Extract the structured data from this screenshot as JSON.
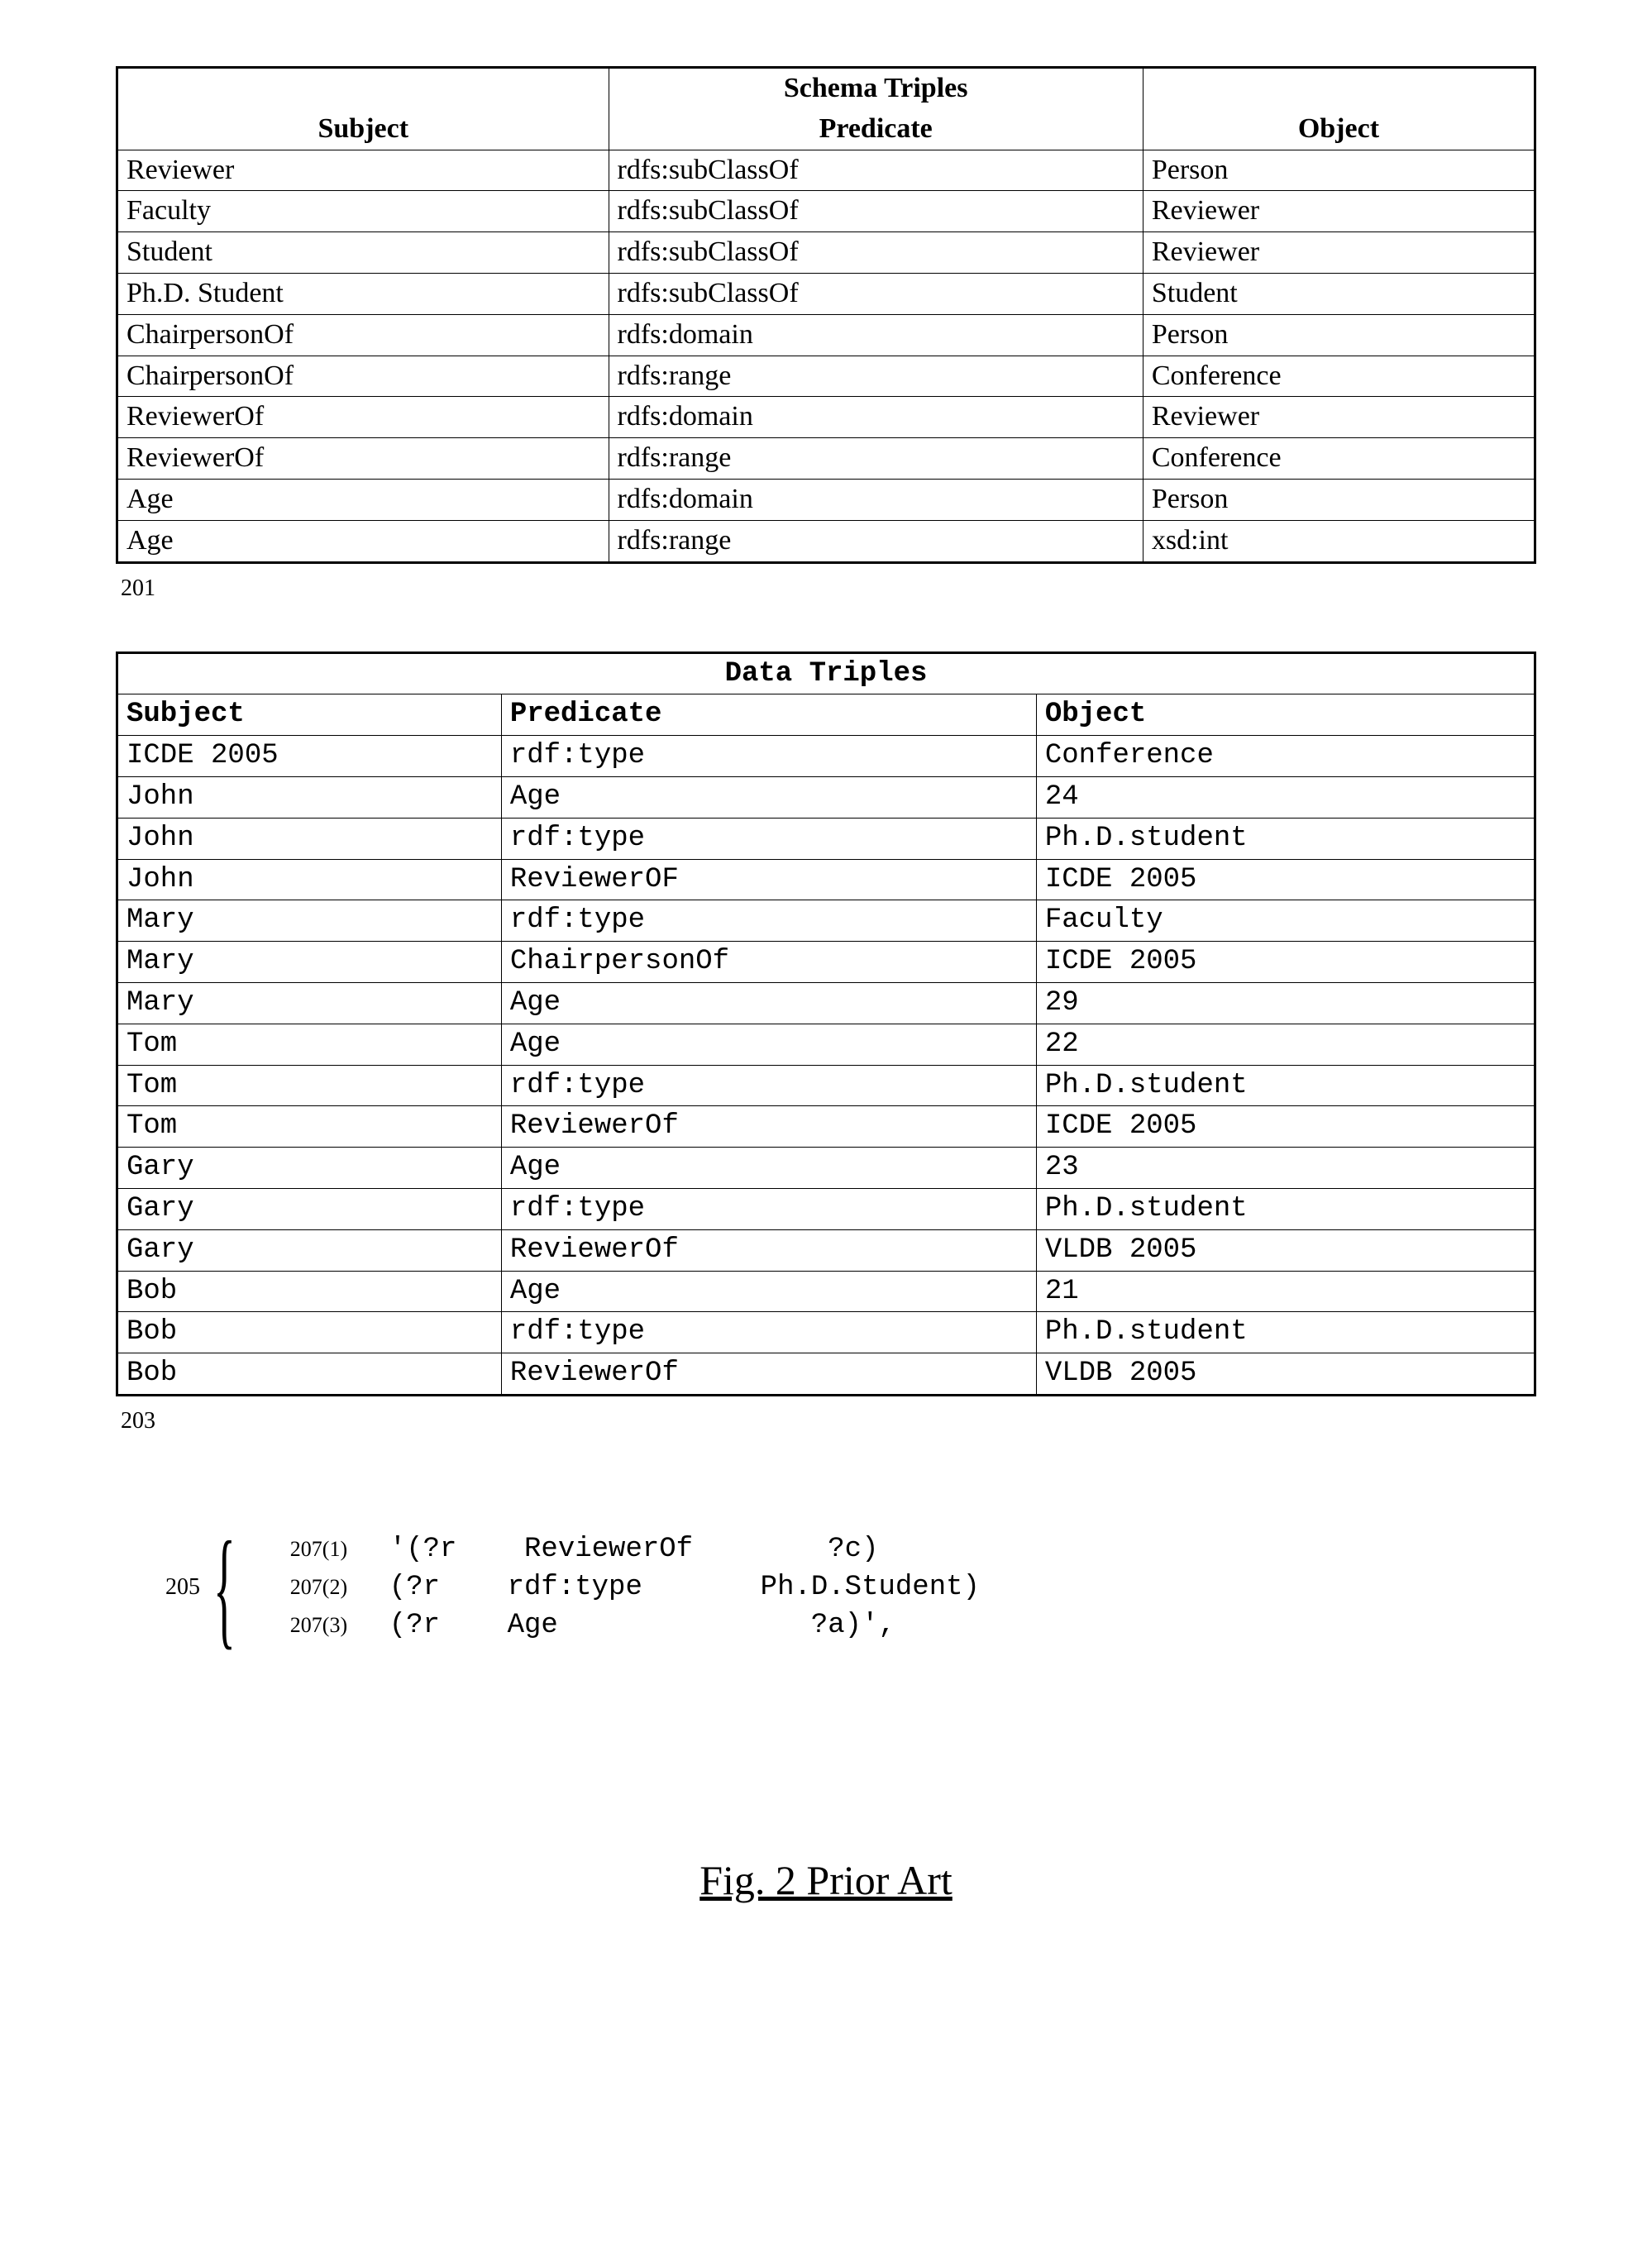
{
  "schema_table": {
    "title": "Schema Triples",
    "headers": {
      "subject": "Subject",
      "predicate": "Predicate",
      "object": "Object"
    },
    "rows": [
      {
        "s": "Reviewer",
        "p": "rdfs:subClassOf",
        "o": "Person"
      },
      {
        "s": "Faculty",
        "p": "rdfs:subClassOf",
        "o": "Reviewer"
      },
      {
        "s": "Student",
        "p": "rdfs:subClassOf",
        "o": "Reviewer"
      },
      {
        "s": "Ph.D. Student",
        "p": "rdfs:subClassOf",
        "o": "Student"
      },
      {
        "s": "ChairpersonOf",
        "p": "rdfs:domain",
        "o": "Person"
      },
      {
        "s": "ChairpersonOf",
        "p": "rdfs:range",
        "o": "Conference"
      },
      {
        "s": "ReviewerOf",
        "p": "rdfs:domain",
        "o": "Reviewer"
      },
      {
        "s": "ReviewerOf",
        "p": "rdfs:range",
        "o": "Conference"
      },
      {
        "s": "Age",
        "p": "rdfs:domain",
        "o": "Person"
      },
      {
        "s": "Age",
        "p": "rdfs:range",
        "o": "xsd:int"
      }
    ],
    "ref": "201"
  },
  "data_table": {
    "title": "Data Triples",
    "headers": {
      "subject": "Subject",
      "predicate": "Predicate",
      "object": "Object"
    },
    "rows": [
      {
        "s": "ICDE 2005",
        "p": "rdf:type",
        "o": "Conference"
      },
      {
        "s": "John",
        "p": "Age",
        "o": "24"
      },
      {
        "s": "John",
        "p": "rdf:type",
        "o": "Ph.D.student"
      },
      {
        "s": "John",
        "p": "ReviewerOF",
        "o": "ICDE 2005"
      },
      {
        "s": "Mary",
        "p": "rdf:type",
        "o": "Faculty"
      },
      {
        "s": "Mary",
        "p": "ChairpersonOf",
        "o": "ICDE 2005"
      },
      {
        "s": "Mary",
        "p": "Age",
        "o": "29"
      },
      {
        "s": "Tom",
        "p": "Age",
        "o": "22"
      },
      {
        "s": "Tom",
        "p": "rdf:type",
        "o": "Ph.D.student"
      },
      {
        "s": "Tom",
        "p": "ReviewerOf",
        "o": "ICDE 2005"
      },
      {
        "s": "Gary",
        "p": "Age",
        "o": "23"
      },
      {
        "s": "Gary",
        "p": "rdf:type",
        "o": "Ph.D.student"
      },
      {
        "s": "Gary",
        "p": "ReviewerOf",
        "o": "VLDB 2005"
      },
      {
        "s": "Bob",
        "p": "Age",
        "o": "21"
      },
      {
        "s": "Bob",
        "p": "rdf:type",
        "o": "Ph.D.student"
      },
      {
        "s": "Bob",
        "p": "ReviewerOf",
        "o": "VLDB 2005"
      }
    ],
    "ref": "203"
  },
  "query": {
    "ref": "205",
    "lines": [
      {
        "tag": "207(1)",
        "text": "'(?r    ReviewerOf        ?c)"
      },
      {
        "tag": "207(2)",
        "text": "(?r    rdf:type       Ph.D.Student)"
      },
      {
        "tag": "207(3)",
        "text": "(?r    Age               ?a)',"
      }
    ]
  },
  "caption": "Fig. 2 Prior Art"
}
